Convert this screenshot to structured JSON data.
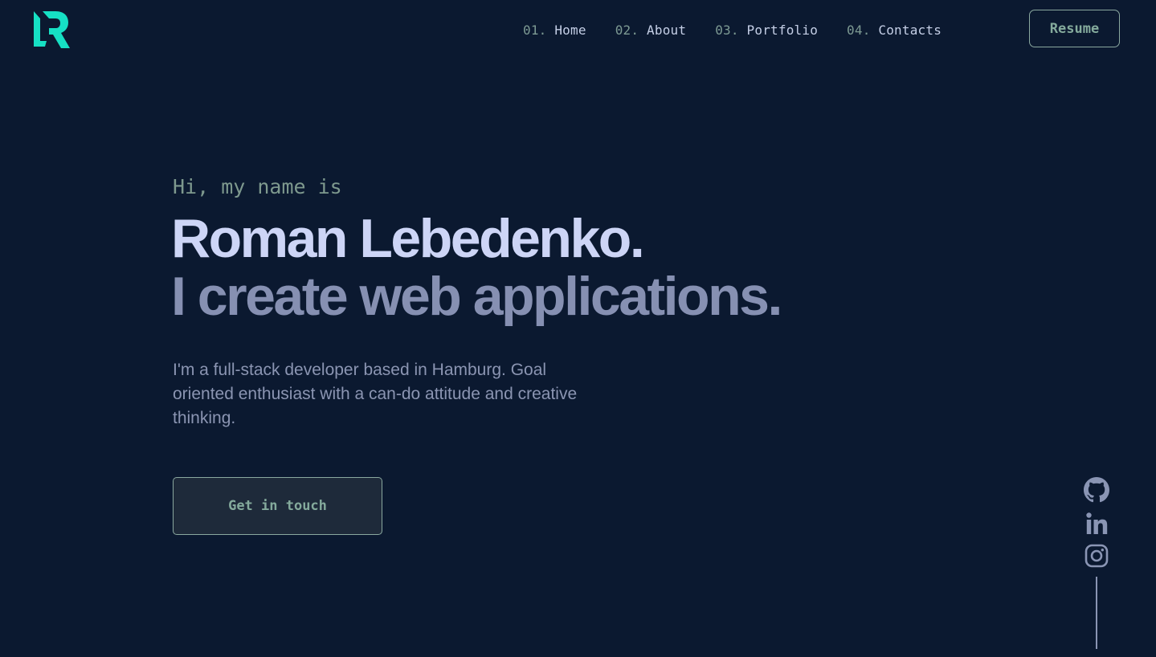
{
  "header": {
    "logo_icon": "r-monogram-logo",
    "nav": [
      {
        "number": "01.",
        "label": "Home"
      },
      {
        "number": "02.",
        "label": "About"
      },
      {
        "number": "03.",
        "label": "Portfolio"
      },
      {
        "number": "04.",
        "label": "Contacts"
      }
    ],
    "resume_label": "Resume"
  },
  "hero": {
    "greeting": "Hi, my name is",
    "name": "Roman Lebedenko.",
    "tagline": "I create web applications.",
    "intro": "I'm a full-stack developer based in Hamburg. Goal oriented enthusiast with a can-do attitude and creative thinking.",
    "cta_label": "Get in touch"
  },
  "social": {
    "icons": [
      "github-icon",
      "linkedin-icon",
      "instagram-icon"
    ]
  },
  "colors": {
    "background": "#0b1930",
    "accent": "#16e0c4",
    "name_text": "#cdd5f6",
    "muted_text": "#8690b2",
    "mono_green": "#7e998e"
  }
}
